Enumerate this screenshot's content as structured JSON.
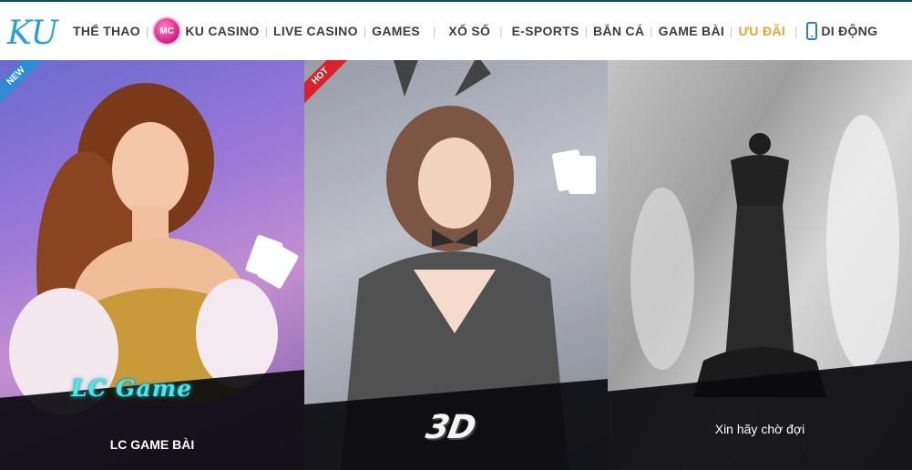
{
  "logo": {
    "text": "KU"
  },
  "nav": [
    {
      "label": "THỂ THAO"
    },
    {
      "label": "KU CASINO",
      "badge": "MC"
    },
    {
      "label": "LIVE CASINO"
    },
    {
      "label": "GAMES"
    },
    {
      "label": "XỔ SỐ"
    },
    {
      "label": "E-SPORTS"
    },
    {
      "label": "BẮN CÁ"
    },
    {
      "label": "GAME BÀI"
    },
    {
      "label": "ƯU ĐÃI"
    },
    {
      "label": "DI ĐỘNG",
      "icon": "phone-icon"
    }
  ],
  "panels": [
    {
      "ribbon": "NEW",
      "brand": "LC Game",
      "caption": "LC GAME BÀI"
    },
    {
      "ribbon": "HOT",
      "brand": "3D",
      "caption": ""
    },
    {
      "caption": "Xin hãy chờ đợi"
    }
  ],
  "colors": {
    "promo": "#e8a531",
    "new_ribbon": "#2d8bd8",
    "hot_ribbon": "#d8232a",
    "brand_cyan": "#52e5e8"
  }
}
